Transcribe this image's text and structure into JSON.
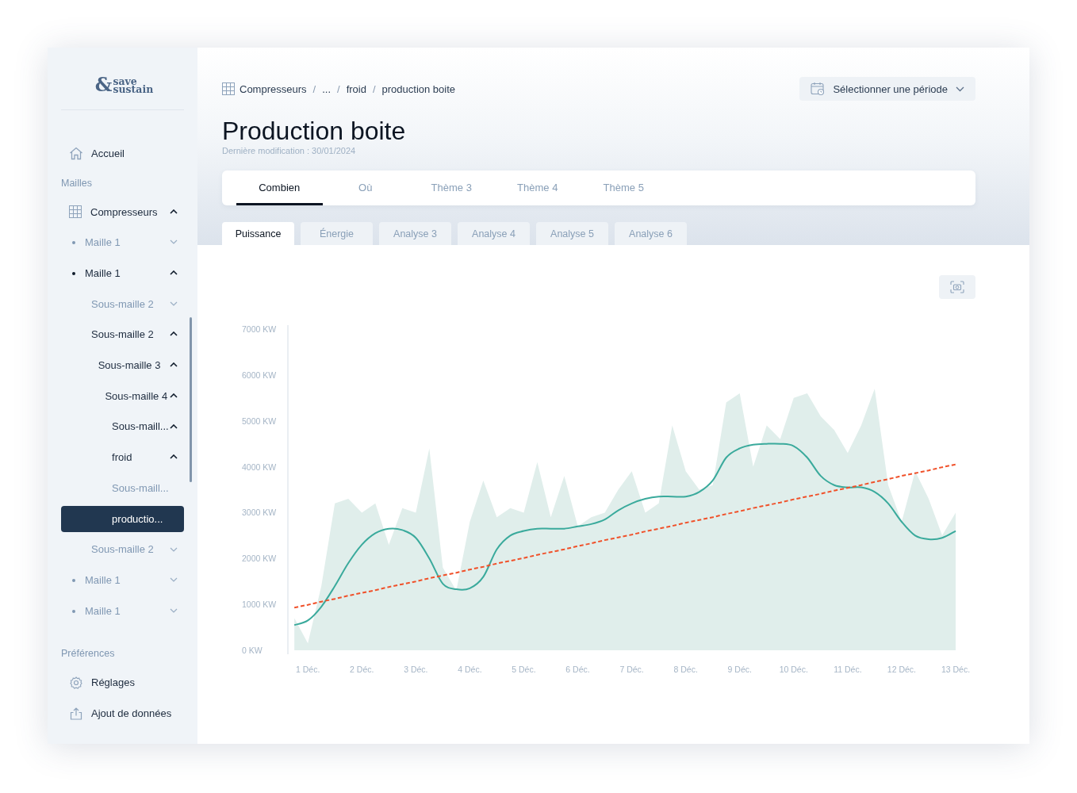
{
  "logo": {
    "mark": "&",
    "top": "save",
    "bottom": "sustain"
  },
  "sidebar": {
    "home": {
      "label": "Accueil"
    },
    "section": "Mailles",
    "tree": [
      {
        "label": "Compresseurs",
        "kind": "root",
        "expanded": true,
        "children": [
          {
            "label": "Maille 1",
            "expanded": false,
            "selected": false
          },
          {
            "label": "Maille 1",
            "expanded": true,
            "selected": false,
            "children": [
              {
                "label": "Sous-maille 2",
                "expanded": false,
                "selected": false
              },
              {
                "label": "Sous-maille 2",
                "expanded": true,
                "selected": false,
                "children": [
                  {
                    "label": "Sous-maille 3",
                    "expanded": true,
                    "selected": false,
                    "children": [
                      {
                        "label": "Sous-maille 4",
                        "expanded": true,
                        "selected": false,
                        "children": [
                          {
                            "label": "Sous-maill...",
                            "expanded": true,
                            "selected": false,
                            "children": [
                              {
                                "label": "froid",
                                "expanded": true,
                                "selected": false,
                                "children": [
                                  {
                                    "label": "Sous-maill...",
                                    "kind": "leaf",
                                    "selected": false
                                  },
                                  {
                                    "label": "productio...",
                                    "kind": "leaf",
                                    "selected": true
                                  }
                                ]
                              }
                            ]
                          }
                        ]
                      }
                    ]
                  }
                ]
              },
              {
                "label": "Sous-maille 2",
                "expanded": false,
                "selected": false
              }
            ]
          },
          {
            "label": "Maille 1",
            "expanded": false,
            "selected": false
          },
          {
            "label": "Maille 1",
            "expanded": false,
            "selected": false
          }
        ]
      }
    ],
    "preferences_title": "Préférences",
    "preferences": [
      {
        "label": "Réglages",
        "kind": "settings"
      },
      {
        "label": "Ajout de données",
        "kind": "upload"
      }
    ]
  },
  "breadcrumb": {
    "separator": "/",
    "items": [
      "Compresseurs",
      "...",
      "froid",
      "production boite"
    ]
  },
  "period_button": {
    "label": "Sélectionner une période"
  },
  "title": "Production boite",
  "subtitle": "Dernière modification : 30/01/2024",
  "tabs": [
    {
      "label": "Combien",
      "selected": true
    },
    {
      "label": "Où",
      "selected": false
    },
    {
      "label": "Thème 3",
      "selected": false
    },
    {
      "label": "Thème 4",
      "selected": false
    },
    {
      "label": "Thème 5",
      "selected": false
    }
  ],
  "subtabs": [
    {
      "label": "Puissance",
      "selected": true
    },
    {
      "label": "Énergie",
      "selected": false
    },
    {
      "label": "Analyse 3",
      "selected": false
    },
    {
      "label": "Analyse 4",
      "selected": false
    },
    {
      "label": "Analyse 5",
      "selected": false
    },
    {
      "label": "Analyse 6",
      "selected": false
    }
  ],
  "chart_data": {
    "type": "area",
    "ylim": [
      0,
      7000
    ],
    "yticks": [
      {
        "value": 0,
        "label": "0 KW"
      },
      {
        "value": 1000,
        "label": "1000 KW"
      },
      {
        "value": 2000,
        "label": "2000 KW"
      },
      {
        "value": 3000,
        "label": "3000 KW"
      },
      {
        "value": 4000,
        "label": "4000 KW"
      },
      {
        "value": 5000,
        "label": "5000 KW"
      },
      {
        "value": 6000,
        "label": "6000 KW"
      },
      {
        "value": 7000,
        "label": "7000 KW"
      }
    ],
    "categories": [
      null,
      "1 Déc.",
      null,
      null,
      null,
      "2 Déc.",
      null,
      null,
      null,
      "3 Déc.",
      null,
      null,
      null,
      "4 Déc.",
      null,
      null,
      null,
      "5 Déc.",
      null,
      null,
      null,
      "6 Déc.",
      null,
      null,
      null,
      "7 Déc.",
      null,
      null,
      null,
      "8 Déc.",
      null,
      null,
      null,
      "9 Déc.",
      null,
      null,
      null,
      "10 Déc.",
      null,
      null,
      null,
      "11 Déc.",
      null,
      null,
      null,
      "12 Déc.",
      null,
      null,
      null,
      "13 Déc."
    ],
    "series": [
      {
        "color": "#e0eeeb",
        "values": [
          700,
          150,
          1400,
          3200,
          3300,
          3000,
          3200,
          2300,
          3100,
          3000,
          4400,
          1800,
          1300,
          2800,
          3700,
          2900,
          3100,
          3000,
          4100,
          2900,
          3800,
          2700,
          2900,
          3000,
          3500,
          3900,
          3000,
          3200,
          4900,
          3900,
          3500,
          3600,
          5400,
          5600,
          4000,
          4900,
          4600,
          5500,
          5600,
          5100,
          4800,
          4300,
          4900,
          5700,
          3600,
          2800,
          3900,
          3300,
          2500,
          3000
        ]
      },
      {
        "type": "line",
        "color": "#3aaa9c",
        "values": [
          550,
          650,
          950,
          1400,
          1900,
          2300,
          2550,
          2650,
          2620,
          2450,
          2000,
          1450,
          1330,
          1350,
          1600,
          2200,
          2500,
          2600,
          2650,
          2650,
          2650,
          2700,
          2750,
          2850,
          3050,
          3200,
          3300,
          3350,
          3350,
          3350,
          3450,
          3700,
          4200,
          4400,
          4480,
          4500,
          4500,
          4450,
          4200,
          3800,
          3600,
          3550,
          3550,
          3450,
          3200,
          2800,
          2500,
          2420,
          2450,
          2600
        ]
      },
      {
        "type": "line",
        "line_style": "dashed",
        "color": "#f0512a",
        "values": [
          930,
          990,
          1060,
          1120,
          1190,
          1250,
          1310,
          1380,
          1440,
          1500,
          1570,
          1630,
          1690,
          1760,
          1820,
          1890,
          1950,
          2010,
          2080,
          2140,
          2200,
          2270,
          2330,
          2400,
          2460,
          2520,
          2590,
          2650,
          2710,
          2780,
          2840,
          2900,
          2970,
          3030,
          3100,
          3160,
          3220,
          3290,
          3350,
          3410,
          3480,
          3540,
          3600,
          3670,
          3730,
          3800,
          3860,
          3920,
          3990,
          4050
        ]
      }
    ]
  }
}
